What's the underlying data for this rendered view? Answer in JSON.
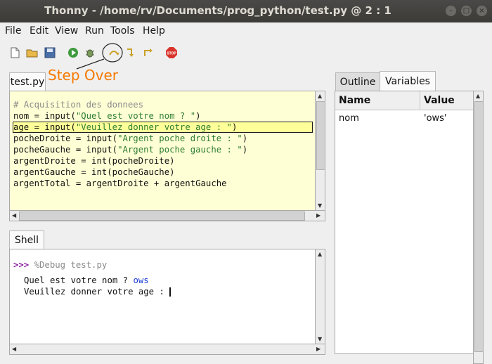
{
  "window": {
    "title": "Thonny  -  /home/rv/Documents/prog_python/test.py  @  2 : 1"
  },
  "menu": [
    "File",
    "Edit",
    "View",
    "Run",
    "Tools",
    "Help"
  ],
  "toolbar": {
    "icons": [
      "new-file-icon",
      "open-folder-icon",
      "save-icon",
      "run-icon",
      "debug-icon",
      "step-over-icon",
      "step-into-icon",
      "step-out-icon",
      "stop-icon"
    ],
    "stop_label": "STOP"
  },
  "annotation": {
    "text": "Step Over"
  },
  "editor": {
    "tab": "test.py",
    "lines": [
      "# Acquisition des donnees",
      "nom = input(\"Quel est votre nom ? \")",
      "age = input(\"Veuillez donner votre age : \")",
      "pocheDroite = input(\"Argent poche droite : \")",
      "pocheGauche = input(\"Argent poche gauche : \")",
      "argentDroite = int(pocheDroite)",
      "argentGauche = int(pocheGauche)",
      "argentTotal = argentDroite + argentGauche"
    ],
    "highlighted_line": 2
  },
  "shell": {
    "tab": "Shell",
    "prompt": ">>>",
    "command": "%Debug test.py",
    "out1": "Quel est votre nom ? ",
    "input1": "ows",
    "out2": "Veuillez donner votre age : "
  },
  "side": {
    "tabs": [
      "Outline",
      "Variables"
    ],
    "active_tab": "Variables",
    "columns": [
      "Name",
      "Value"
    ],
    "rows": [
      {
        "name": "nom",
        "value": "'ows'"
      }
    ]
  }
}
